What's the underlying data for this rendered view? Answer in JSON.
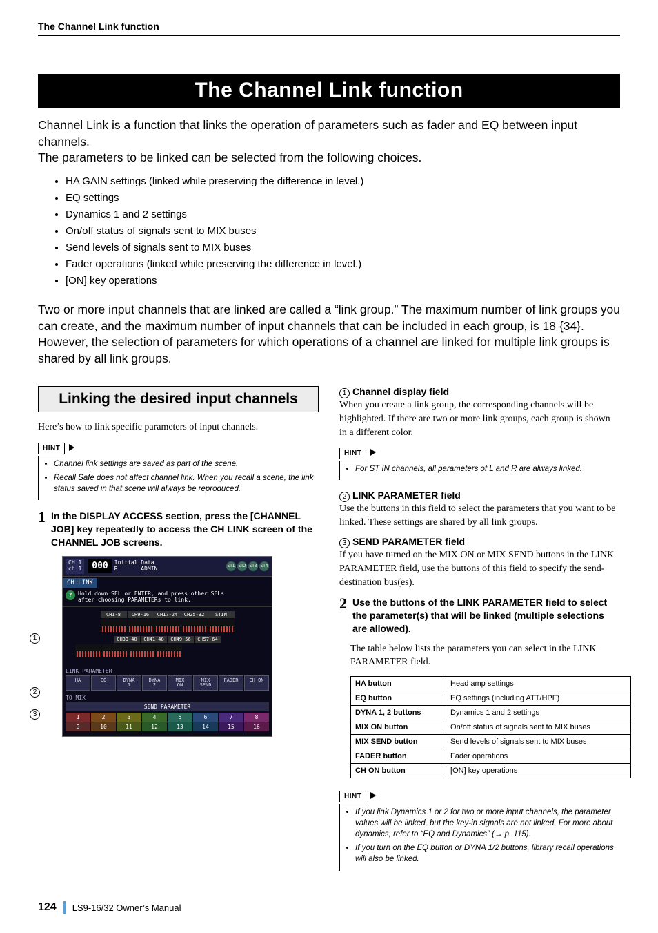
{
  "header": {
    "label": "The Channel Link function"
  },
  "title": "The Channel Link function",
  "intro": "Channel Link is a function that links the operation of parameters such as fader and EQ between input channels.\nThe parameters to be linked can be selected from the following choices.",
  "bullets": [
    "HA GAIN settings (linked while preserving the difference in level.)",
    "EQ settings",
    "Dynamics 1 and 2 settings",
    "On/off status of signals sent to MIX buses",
    "Send levels of signals sent to MIX buses",
    "Fader operations (linked while preserving the difference in level.)",
    "[ON] key operations"
  ],
  "after_bullets": "Two or more input channels that are linked are called a “link group.” The maximum number of link groups you can create, and the maximum number of input channels that can be included in each group, is 18 {34}. However, the selection of parameters for which operations of a channel are linked for multiple link groups is shared by all link groups.",
  "left": {
    "section_title": "Linking the desired input channels",
    "lead": "Here’s how to link specific parameters of input channels.",
    "hint_label": "HINT",
    "hints": [
      "Channel link settings are saved as part of the scene.",
      "Recall Safe does not affect channel link. When you recall a scene, the link status saved in that scene will always be reproduced."
    ],
    "step1_num": "1",
    "step1": "In the DISPLAY ACCESS section, press the [CHANNEL JOB] key repeatedly to access the CH LINK screen of the CHANNEL JOB screens."
  },
  "screen": {
    "ch_label_top": "CH 1",
    "ch_label_bot": "ch 1",
    "scene_num": "000",
    "scene_top": "Initial Data",
    "scene_r": "R",
    "scene_admin": "ADMIN",
    "st": [
      "ST1",
      "ST2",
      "ST3",
      "ST4"
    ],
    "tab": "CH LINK",
    "hint_line1": "Hold down SEL or ENTER, and press other SELs",
    "hint_line2": "after choosing PARAMETERs to link.",
    "ch_row1": [
      "CH1-8",
      "CH9-16",
      "CH17-24",
      "CH25-32",
      "STIN"
    ],
    "ch_row2": [
      "CH33-40",
      "CH41-48",
      "CH49-56",
      "CH57-64"
    ],
    "link_param_label": "LINK PARAMETER",
    "link_btns": [
      "HA",
      "EQ",
      "DYNA\n1",
      "DYNA\n2",
      "MIX\nON",
      "MIX\nSEND",
      "FADER",
      "CH ON"
    ],
    "to_mix": "TO MIX",
    "send_title": "SEND PARAMETER",
    "send_row1": [
      "1",
      "2",
      "3",
      "4",
      "5",
      "6",
      "7",
      "8"
    ],
    "send_row2": [
      "9",
      "10",
      "11",
      "12",
      "13",
      "14",
      "15",
      "16"
    ],
    "callouts": [
      "1",
      "2",
      "3"
    ]
  },
  "right": {
    "h1_num": "1",
    "h1": "Channel display field",
    "p1": "When you create a link group, the corresponding channels will be highlighted. If there are two or more link groups, each group is shown in a different color.",
    "hint_label": "HINT",
    "hints1": [
      "For ST IN channels, all parameters of L and R are always linked."
    ],
    "h2_num": "2",
    "h2": "LINK PARAMETER field",
    "p2": "Use the buttons in this field to select the parameters that you want to be linked. These settings are shared by all link groups.",
    "h3_num": "3",
    "h3": "SEND PARAMETER field",
    "p3": "If you have turned on the MIX ON or MIX SEND buttons in the LINK PARAMETER field, use the buttons of this field to specify the send-destination bus(es).",
    "step2_num": "2",
    "step2": "Use the buttons of the LINK PARAMETER field to select the parameter(s) that will be linked (multiple selections are allowed).",
    "step2_follow": "The table below lists the parameters you can select in the LINK PARAMETER field.",
    "table": [
      [
        "HA button",
        "Head amp settings"
      ],
      [
        "EQ button",
        "EQ settings (including ATT/HPF)"
      ],
      [
        "DYNA 1, 2 buttons",
        "Dynamics 1 and 2 settings"
      ],
      [
        "MIX ON button",
        "On/off status of signals sent to MIX buses"
      ],
      [
        "MIX SEND button",
        "Send levels of signals sent to MIX buses"
      ],
      [
        "FADER button",
        "Fader operations"
      ],
      [
        "CH ON button",
        "[ON] key operations"
      ]
    ],
    "hints2": [
      "If you link Dynamics 1 or 2 for two or more input channels, the parameter values will be linked, but the key-in signals are not linked. For more about dynamics, refer to “EQ and Dynamics” (→ p. 115).",
      "If you turn on the EQ button or DYNA 1/2 buttons, library recall operations will also be linked."
    ]
  },
  "footer": {
    "page": "124",
    "manual": "LS9-16/32  Owner’s Manual"
  }
}
